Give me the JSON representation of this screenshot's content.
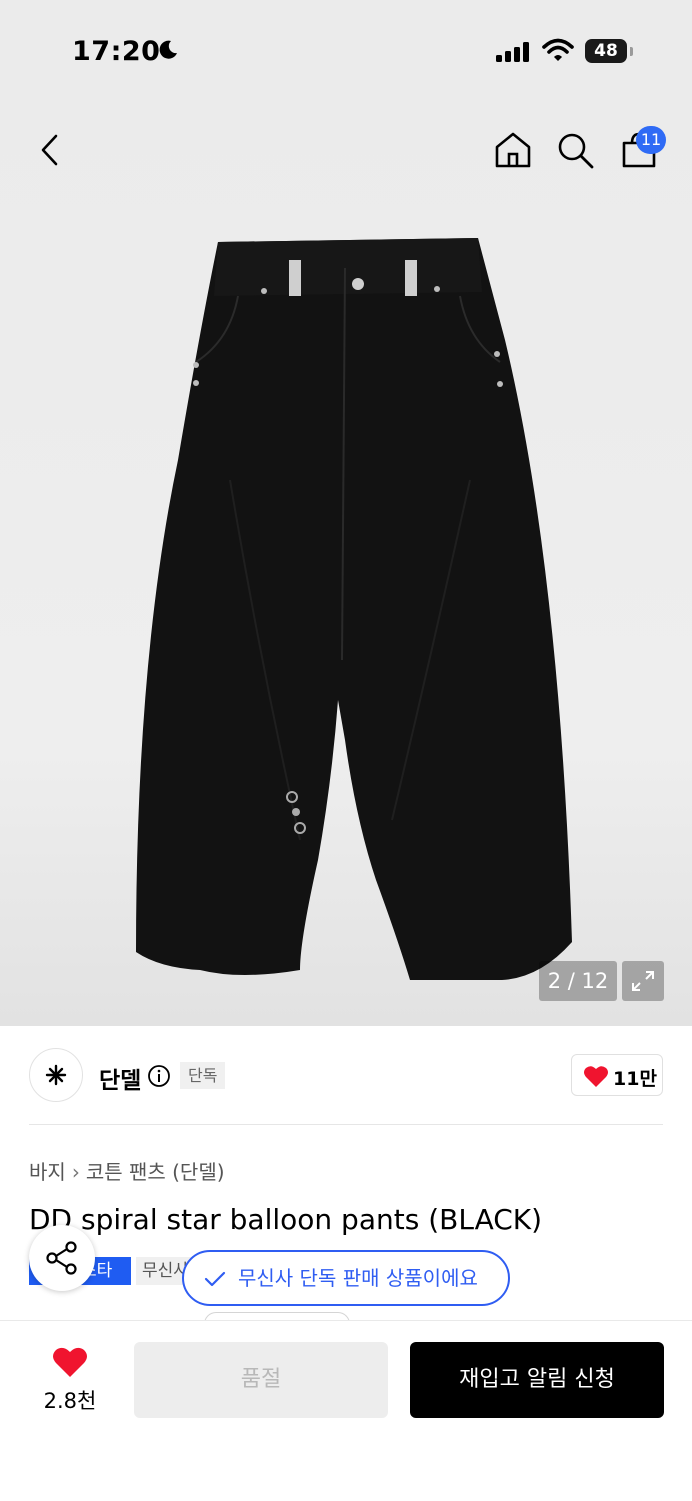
{
  "status_bar": {
    "time": "17:20",
    "battery": "48"
  },
  "header": {
    "cart_count": "11"
  },
  "gallery": {
    "counter": "2 / 12"
  },
  "brand": {
    "name": "단델",
    "exclusive_tag": "단독",
    "likes": "11만"
  },
  "product": {
    "breadcrumb": [
      "바지",
      "코튼 팬츠 (단델)"
    ],
    "title": "DD spiral star balloon pants (BLACK)",
    "tag_blue": "스타",
    "tag_gray": "무신사"
  },
  "toast": {
    "message": "무신사 단독 판매 상품이에요"
  },
  "bottom_bar": {
    "like_count": "2.8천",
    "soldout_label": "품절",
    "restock_label": "재입고 알림 신청"
  },
  "colors": {
    "accent_blue": "#2f5df2",
    "heart_red": "#f0142f"
  }
}
